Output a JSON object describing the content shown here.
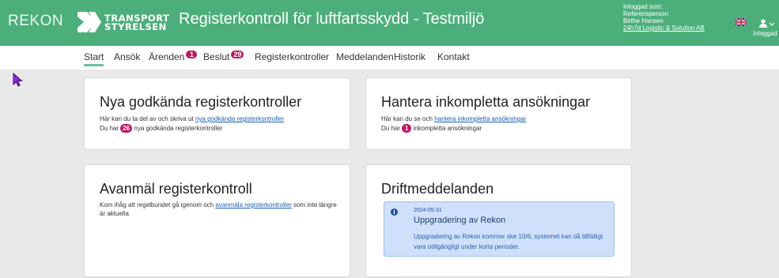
{
  "header": {
    "brand": "REKON",
    "logo_line1": "TRANSPORT",
    "logo_line2": "STYRELSEN",
    "title": "Registerkontroll för luftfartsskydd - Testmiljö",
    "user_label": "Inloggad som:",
    "user_role": "Referensperson",
    "user_name": "Birthe Hansen",
    "user_company": "24h7d Logistic & Solution AB",
    "account_label": "Inloggad"
  },
  "nav": {
    "items": [
      {
        "label": "Start"
      },
      {
        "label": "Ansök"
      },
      {
        "label": "Ärenden",
        "badge": "1"
      },
      {
        "label": "Beslut",
        "badge": "29"
      },
      {
        "label": "Registerkontroller"
      },
      {
        "label": "Meddelanden"
      },
      {
        "label": "Historik"
      },
      {
        "label": "Kontakt"
      }
    ]
  },
  "cards": {
    "approved": {
      "title": "Nya godkända registerkontroller",
      "line1_pre": "Här kan du ta del av och skriva ut ",
      "line1_link": "nya godkända registerkontroller",
      "line2_pre": "Du har ",
      "count": "26",
      "line2_post": " nya godkända registerkontroller"
    },
    "incomplete": {
      "title": "Hantera inkompletta ansökningar",
      "line1_pre": "Här kan du se och ",
      "line1_link": "hantera inkompletta ansökningar",
      "line2_pre": "Du har ",
      "count": "1",
      "line2_post": " inkompletta ansökningar"
    },
    "deregister": {
      "title": "Avanmäl registerkontroll",
      "line1_pre": "Kom ihåg att regelbundet gå igenom och ",
      "line1_link": "avanmäla registerkontroller",
      "line1_post": " som inte längre är aktuella"
    },
    "operations": {
      "title": "Driftmeddelanden",
      "notice": {
        "date": "2024-05-31",
        "title": "Uppgradering av Rekon",
        "body": "Uppgradering av Rekon kommer ske 10/6, systemet kan då tillfälligt vara otillgängligt under korta perioder."
      }
    }
  },
  "icons": {
    "flag": "uk-flag-icon",
    "account": "user-account-icon",
    "info": "info-icon",
    "cursor": "mouse-pointer-icon"
  },
  "colors": {
    "header_bg": "#4caf7b",
    "badge": "#c0185f",
    "link": "#1a5fb4",
    "notice_bg": "#cfe0fb"
  }
}
